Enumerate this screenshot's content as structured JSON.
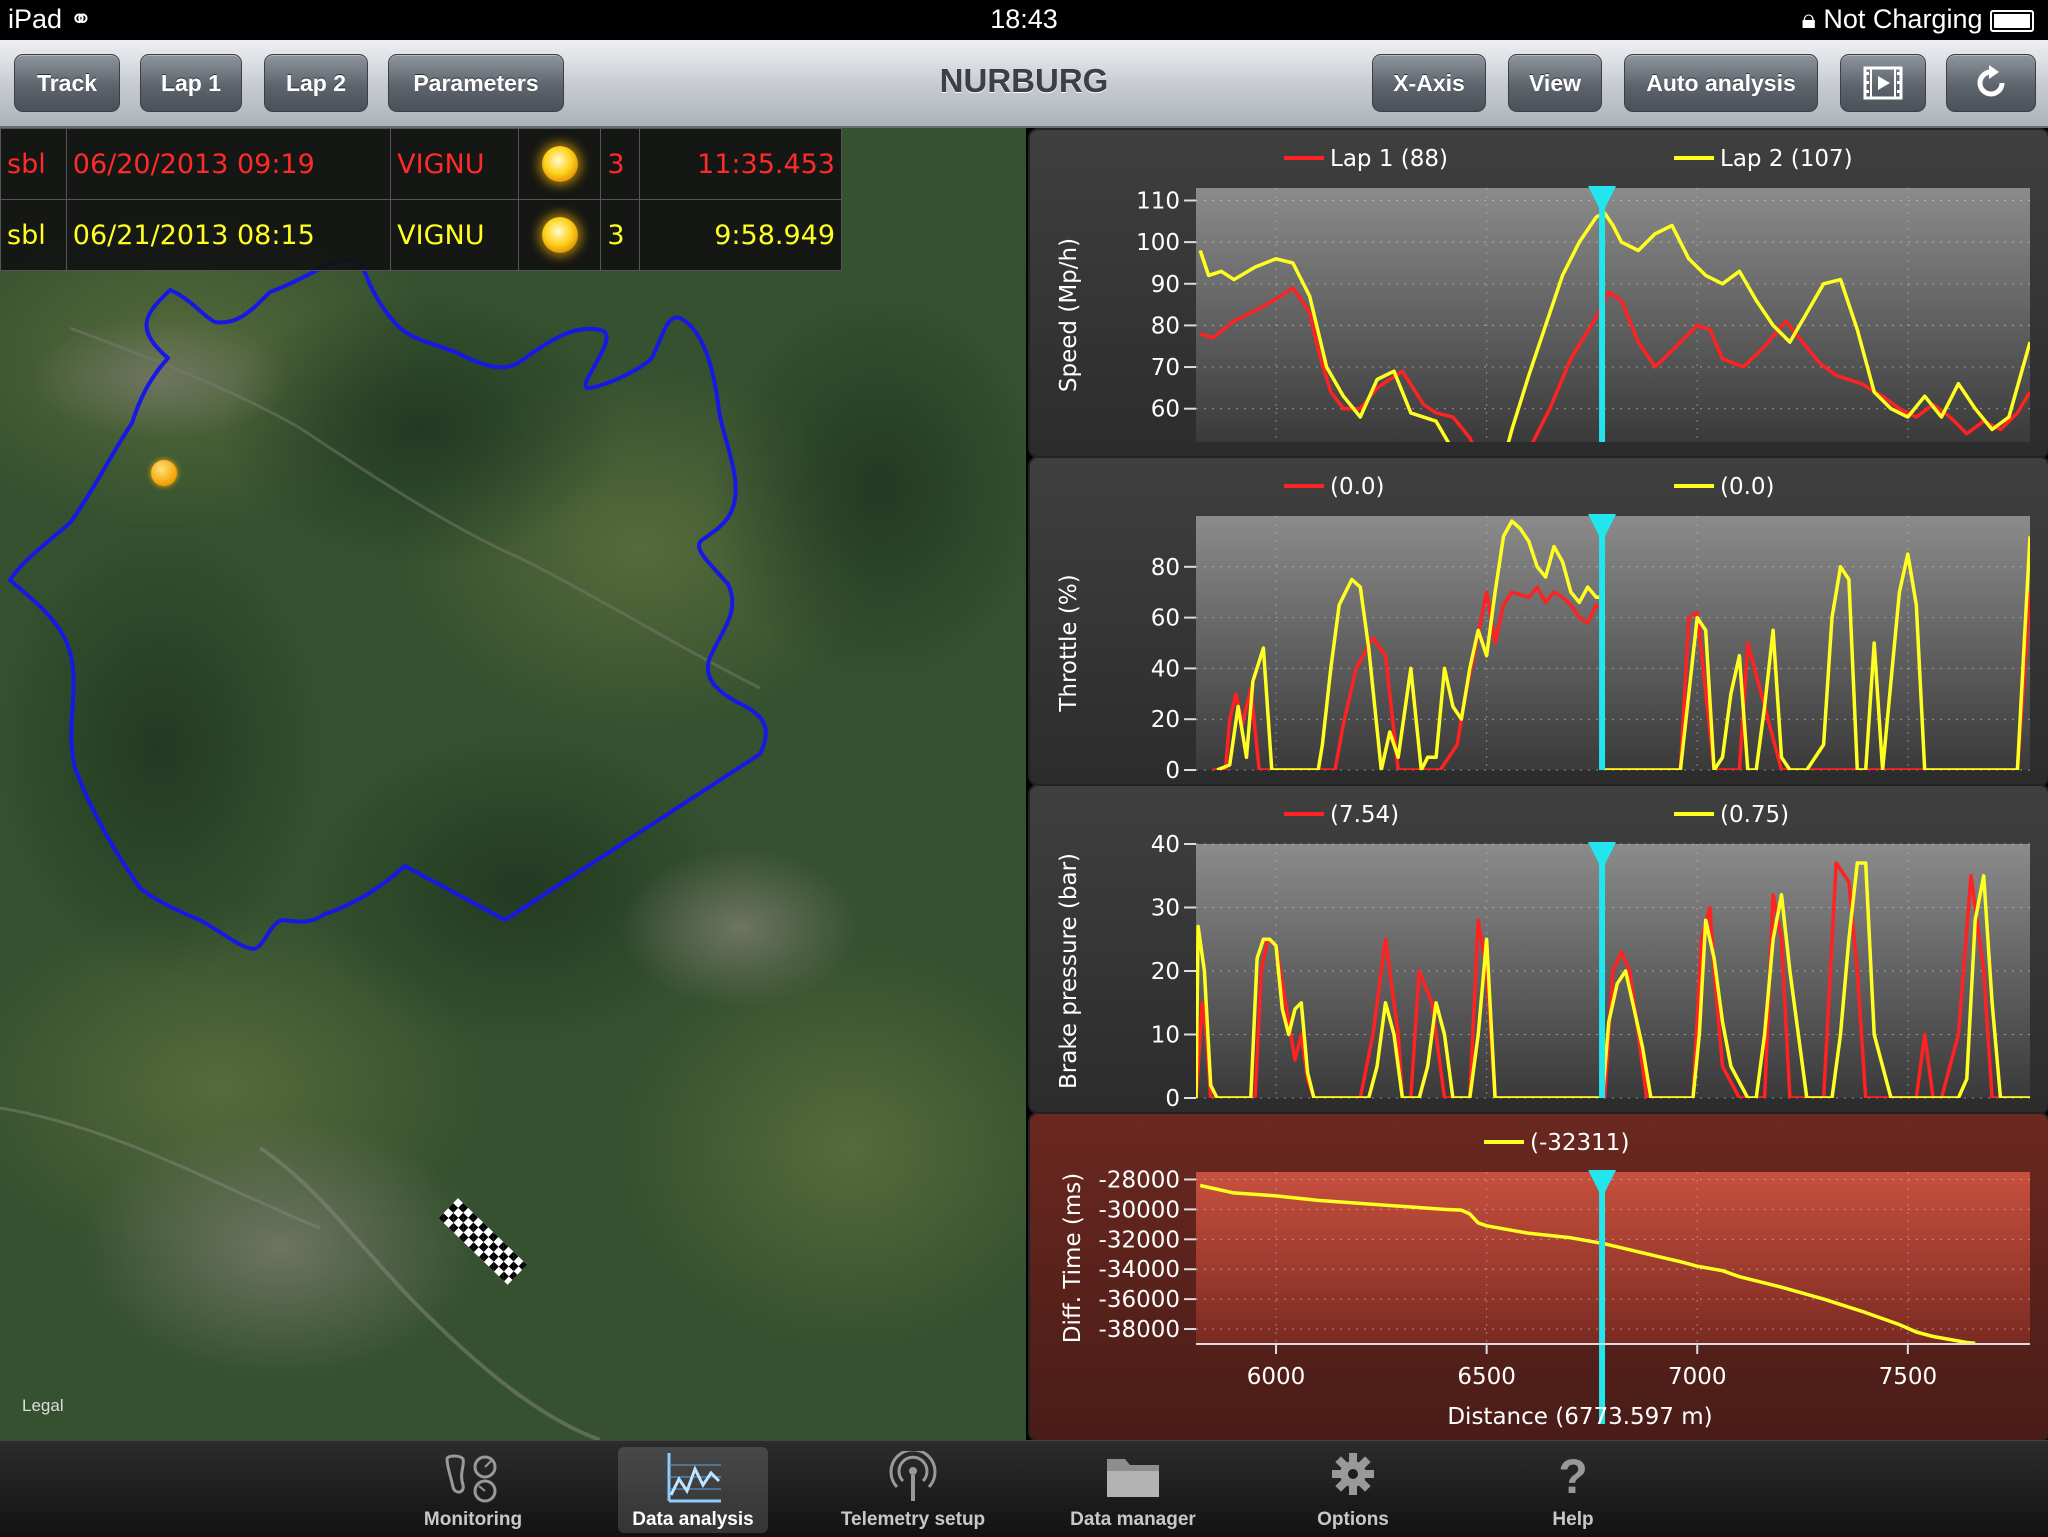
{
  "status_bar": {
    "device": "iPad",
    "time": "18:43",
    "battery": "Not Charging"
  },
  "toolbar": {
    "title": "NURBURG",
    "left_buttons": [
      "Track",
      "Lap 1",
      "Lap 2",
      "Parameters"
    ],
    "right_buttons": [
      "X-Axis",
      "View",
      "Auto analysis"
    ]
  },
  "laps": [
    {
      "user": "sbl",
      "date": "06/20/2013 09:19",
      "driver": "VIGNU",
      "weather": "sun-icon",
      "count": "3",
      "time": "11:35.453",
      "color": "#ff2a2a"
    },
    {
      "user": "sbl",
      "date": "06/21/2013 08:15",
      "driver": "VIGNU",
      "weather": "sun-icon",
      "count": "3",
      "time": "9:58.949",
      "color": "#ffff22"
    }
  ],
  "map": {
    "legal": "Legal"
  },
  "colors": {
    "lap1": "#ff2222",
    "lap2": "#ffff22",
    "cursor": "#22e5ee"
  },
  "chart_data": [
    {
      "type": "line",
      "title": "",
      "ylabel": "Speed (Mp/h)",
      "legend": [
        {
          "name": "Lap 1 (88)",
          "color": "#ff2222"
        },
        {
          "name": "Lap 2 (107)",
          "color": "#ffff22"
        }
      ],
      "ylim": [
        52,
        113
      ],
      "yticks": [
        60,
        70,
        80,
        90,
        100,
        110
      ],
      "xlim": [
        5810,
        7790
      ],
      "cursor_x": 6774,
      "series": [
        {
          "name": "Lap 1 (88)",
          "color": "#ff2222",
          "x": [
            5820,
            5850,
            5900,
            5960,
            6010,
            6040,
            6080,
            6100,
            6130,
            6160,
            6200,
            6240,
            6300,
            6350,
            6380,
            6420,
            6460,
            6520,
            6560,
            6600,
            6650,
            6700,
            6760,
            6790,
            6820,
            6860,
            6900,
            6960,
            7000,
            7030,
            7060,
            7110,
            7160,
            7210,
            7250,
            7290,
            7330,
            7390,
            7440,
            7480,
            7520,
            7560,
            7600,
            7640,
            7680,
            7720,
            7760,
            7790
          ],
          "values": [
            78,
            77,
            81,
            84,
            87,
            89,
            83,
            74,
            64,
            60,
            60,
            65,
            69,
            61,
            59,
            58,
            53,
            40,
            40,
            50,
            60,
            72,
            82,
            88,
            86,
            76,
            70,
            76,
            80,
            79,
            72,
            70,
            75,
            81,
            76,
            71,
            68,
            66,
            63,
            60,
            58,
            61,
            58,
            54,
            57,
            55,
            59,
            64
          ]
        },
        {
          "name": "Lap 2 (107)",
          "color": "#ffff22",
          "x": [
            5820,
            5840,
            5870,
            5900,
            5950,
            6000,
            6040,
            6080,
            6120,
            6160,
            6200,
            6240,
            6280,
            6320,
            6380,
            6420,
            6460,
            6520,
            6560,
            6600,
            6640,
            6680,
            6720,
            6760,
            6780,
            6800,
            6820,
            6860,
            6900,
            6940,
            6980,
            7020,
            7060,
            7100,
            7140,
            7180,
            7220,
            7260,
            7300,
            7340,
            7380,
            7420,
            7460,
            7500,
            7540,
            7580,
            7620,
            7660,
            7700,
            7740,
            7790
          ],
          "values": [
            98,
            92,
            93,
            91,
            94,
            96,
            95,
            87,
            70,
            63,
            58,
            67,
            69,
            59,
            57,
            50,
            40,
            40,
            55,
            68,
            80,
            92,
            100,
            106,
            107,
            104,
            100,
            98,
            102,
            104,
            96,
            92,
            90,
            93,
            86,
            80,
            76,
            83,
            90,
            91,
            79,
            64,
            60,
            58,
            63,
            58,
            66,
            60,
            55,
            58,
            76
          ]
        }
      ]
    },
    {
      "type": "line",
      "title": "",
      "ylabel": "Throttle (%)",
      "legend": [
        {
          "name": "(0.0)",
          "color": "#ff2222"
        },
        {
          "name": "(0.0)",
          "color": "#ffff22"
        }
      ],
      "ylim": [
        0,
        100
      ],
      "yticks": [
        0,
        20,
        40,
        60,
        80
      ],
      "xlim": [
        5810,
        7790
      ],
      "cursor_x": 6774,
      "series": [
        {
          "name": "(0.0)",
          "color": "#ff2222",
          "x": [
            5850,
            5880,
            5890,
            5905,
            5920,
            5940,
            5960,
            5990,
            6010,
            6080,
            6120,
            6140,
            6160,
            6190,
            6230,
            6260,
            6290,
            6320,
            6350,
            6380,
            6390,
            6410,
            6430,
            6450,
            6470,
            6500,
            6520,
            6540,
            6560,
            6600,
            6620,
            6640,
            6660,
            6680,
            6700,
            6720,
            6740,
            6760,
            6775,
            6776,
            6900,
            6920,
            6940,
            6960,
            6980,
            7000,
            7040,
            7060,
            7080,
            7100,
            7120,
            7200,
            7220,
            7240,
            7260,
            7280,
            7300,
            7340,
            7360,
            7380,
            7400,
            7420,
            7460,
            7500,
            7520,
            7540,
            7560,
            7600,
            7640,
            7660,
            7680,
            7700,
            7720,
            7740,
            7760,
            7790
          ],
          "values": [
            0,
            0,
            20,
            30,
            18,
            32,
            0,
            0,
            0,
            0,
            0,
            0,
            18,
            40,
            52,
            45,
            0,
            0,
            0,
            0,
            0,
            5,
            10,
            30,
            45,
            70,
            50,
            65,
            70,
            68,
            72,
            66,
            70,
            68,
            65,
            60,
            58,
            65,
            63,
            0,
            0,
            0,
            0,
            0,
            60,
            62,
            0,
            0,
            0,
            0,
            50,
            0,
            0,
            0,
            0,
            0,
            0,
            0,
            0,
            0,
            0,
            0,
            0,
            0,
            0,
            0,
            0,
            0,
            0,
            0,
            0,
            0,
            0,
            0,
            0,
            70
          ]
        },
        {
          "name": "(0.0)",
          "color": "#ffff22",
          "x": [
            5860,
            5890,
            5910,
            5930,
            5945,
            5970,
            5990,
            6070,
            6100,
            6110,
            6130,
            6150,
            6180,
            6200,
            6220,
            6250,
            6270,
            6290,
            6320,
            6345,
            6360,
            6380,
            6400,
            6420,
            6440,
            6460,
            6480,
            6500,
            6520,
            6540,
            6560,
            6580,
            6600,
            6620,
            6640,
            6660,
            6680,
            6700,
            6720,
            6740,
            6760,
            6775,
            6776,
            6900,
            6920,
            6940,
            6960,
            7000,
            7020,
            7040,
            7060,
            7080,
            7100,
            7120,
            7140,
            7160,
            7180,
            7200,
            7220,
            7240,
            7260,
            7300,
            7320,
            7340,
            7360,
            7380,
            7400,
            7420,
            7440,
            7460,
            7480,
            7500,
            7520,
            7540,
            7560,
            7580,
            7600,
            7640,
            7660,
            7680,
            7700,
            7720,
            7740,
            7760,
            7790
          ],
          "values": [
            0,
            2,
            25,
            5,
            35,
            48,
            0,
            0,
            0,
            10,
            40,
            65,
            75,
            72,
            48,
            0,
            15,
            5,
            40,
            0,
            5,
            5,
            40,
            25,
            20,
            40,
            55,
            45,
            70,
            92,
            98,
            95,
            90,
            80,
            76,
            88,
            82,
            70,
            66,
            72,
            68,
            68,
            0,
            0,
            0,
            0,
            0,
            60,
            55,
            0,
            5,
            30,
            45,
            0,
            0,
            25,
            55,
            5,
            0,
            0,
            0,
            10,
            60,
            80,
            75,
            0,
            0,
            50,
            0,
            35,
            70,
            85,
            65,
            0,
            0,
            0,
            0,
            0,
            0,
            0,
            0,
            0,
            0,
            0,
            92
          ]
        }
      ]
    },
    {
      "type": "line",
      "title": "",
      "ylabel": "Brake pressure (bar)",
      "legend": [
        {
          "name": "(7.54)",
          "color": "#ff2222"
        },
        {
          "name": "(0.75)",
          "color": "#ffff22"
        }
      ],
      "ylim": [
        0,
        40
      ],
      "yticks": [
        0,
        10,
        20,
        30,
        40
      ],
      "xlim": [
        5810,
        7790
      ],
      "cursor_x": 6774,
      "series": [
        {
          "name": "(7.54)",
          "color": "#ff2222",
          "x": [
            5810,
            5825,
            5835,
            5845,
            5870,
            5950,
            5965,
            5980,
            6000,
            6030,
            6045,
            6060,
            6075,
            6090,
            6120,
            6200,
            6230,
            6260,
            6290,
            6300,
            6320,
            6340,
            6370,
            6390,
            6400,
            6460,
            6480,
            6500,
            6520,
            6560,
            6600,
            6620,
            6640,
            6780,
            6800,
            6820,
            6840,
            6860,
            6880,
            6920,
            6960,
            6990,
            7010,
            7030,
            7040,
            7060,
            7100,
            7160,
            7180,
            7200,
            7220,
            7240,
            7260,
            7300,
            7330,
            7360,
            7380,
            7400,
            7440,
            7480,
            7520,
            7540,
            7560,
            7580,
            7620,
            7650,
            7680,
            7700,
            7720,
            7790
          ],
          "values": [
            0,
            15,
            10,
            0,
            0,
            0,
            20,
            25,
            24,
            12,
            6,
            10,
            3,
            0,
            0,
            0,
            10,
            25,
            10,
            0,
            0,
            20,
            15,
            5,
            0,
            0,
            28,
            20,
            0,
            0,
            0,
            0,
            0,
            0,
            20,
            23,
            20,
            10,
            0,
            0,
            0,
            0,
            25,
            30,
            20,
            5,
            0,
            0,
            32,
            25,
            0,
            0,
            0,
            0,
            37,
            34,
            20,
            0,
            0,
            0,
            0,
            10,
            0,
            0,
            10,
            35,
            20,
            0,
            0,
            0
          ]
        },
        {
          "name": "(0.75)",
          "color": "#ffff22",
          "x": [
            5810,
            5815,
            5830,
            5845,
            5860,
            5940,
            5955,
            5970,
            5985,
            6000,
            6015,
            6030,
            6045,
            6060,
            6075,
            6090,
            6110,
            6200,
            6220,
            6240,
            6260,
            6280,
            6300,
            6320,
            6340,
            6360,
            6380,
            6400,
            6420,
            6440,
            6460,
            6480,
            6500,
            6520,
            6560,
            6580,
            6600,
            6620,
            6640,
            6660,
            6680,
            6700,
            6720,
            6760,
            6775,
            6776,
            6790,
            6810,
            6830,
            6850,
            6870,
            6890,
            6920,
            6960,
            6990,
            7005,
            7020,
            7040,
            7060,
            7080,
            7120,
            7140,
            7160,
            7180,
            7200,
            7220,
            7260,
            7300,
            7320,
            7340,
            7360,
            7380,
            7400,
            7420,
            7460,
            7500,
            7540,
            7580,
            7600,
            7620,
            7640,
            7660,
            7680,
            7700,
            7720,
            7790
          ],
          "values": [
            0,
            27,
            20,
            2,
            0,
            0,
            22,
            25,
            25,
            24,
            14,
            10,
            14,
            15,
            4,
            0,
            0,
            0,
            0,
            5,
            15,
            10,
            0,
            0,
            0,
            5,
            15,
            10,
            0,
            0,
            0,
            10,
            25,
            0,
            0,
            0,
            0,
            0,
            0,
            0,
            0,
            0,
            0,
            0,
            0,
            1,
            12,
            18,
            20,
            14,
            8,
            0,
            0,
            0,
            0,
            10,
            28,
            22,
            12,
            5,
            0,
            0,
            10,
            25,
            32,
            20,
            0,
            0,
            0,
            10,
            25,
            37,
            37,
            10,
            0,
            0,
            0,
            0,
            0,
            0,
            3,
            28,
            35,
            15,
            0,
            0
          ]
        }
      ]
    },
    {
      "type": "line",
      "title": "",
      "ylabel": "Diff. Time (ms)",
      "xlabel": "Distance (6773.597 m)",
      "legend": [
        {
          "name": "(-32311)",
          "color": "#ffff22"
        }
      ],
      "ylim": [
        -39000,
        -27500
      ],
      "yticks": [
        -28000,
        -30000,
        -32000,
        -34000,
        -36000,
        -38000
      ],
      "xlim": [
        5810,
        7790
      ],
      "xticks": [
        6000,
        6500,
        7000,
        7500
      ],
      "cursor_x": 6774,
      "series": [
        {
          "name": "(-32311)",
          "color": "#ffff22",
          "x": [
            5820,
            5900,
            6000,
            6100,
            6200,
            6300,
            6400,
            6440,
            6460,
            6480,
            6500,
            6560,
            6600,
            6700,
            6780,
            6840,
            6900,
            6960,
            7000,
            7060,
            7100,
            7200,
            7300,
            7400,
            7440,
            7480,
            7520,
            7560,
            7600,
            7640,
            7660
          ],
          "values": [
            -28400,
            -28900,
            -29100,
            -29400,
            -29600,
            -29800,
            -30000,
            -30050,
            -30300,
            -30900,
            -31100,
            -31400,
            -31600,
            -31900,
            -32300,
            -32700,
            -33100,
            -33500,
            -33800,
            -34100,
            -34500,
            -35200,
            -36000,
            -36900,
            -37300,
            -37700,
            -38200,
            -38500,
            -38700,
            -38900,
            -38950
          ]
        }
      ]
    }
  ],
  "tabs": [
    {
      "label": "Monitoring",
      "icon": "monitoring-icon",
      "selected": false
    },
    {
      "label": "Data analysis",
      "icon": "data-analysis-icon",
      "selected": true
    },
    {
      "label": "Telemetry setup",
      "icon": "antenna-icon",
      "selected": false
    },
    {
      "label": "Data manager",
      "icon": "folder-icon",
      "selected": false
    },
    {
      "label": "Options",
      "icon": "gear-icon",
      "selected": false
    },
    {
      "label": "Help",
      "icon": "help-icon",
      "selected": false
    }
  ]
}
